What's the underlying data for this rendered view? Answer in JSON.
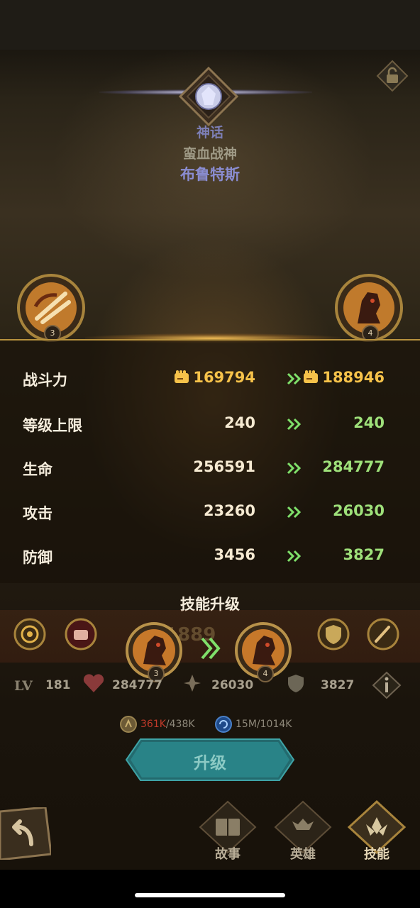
{
  "hero": {
    "rarity": "神话",
    "epithet": "蛮血战神",
    "name": "布鲁特斯"
  },
  "side_skills": {
    "left_level": "3",
    "right_level": "4"
  },
  "stats": {
    "power_label": "战斗力",
    "power_cur": "169794",
    "power_next": "188946",
    "rows": [
      {
        "label": "等级上限",
        "cur": "240",
        "next": "240"
      },
      {
        "label": "生命",
        "cur": "256591",
        "next": "284777"
      },
      {
        "label": "攻击",
        "cur": "23260",
        "next": "26030"
      },
      {
        "label": "防御",
        "cur": "3456",
        "next": "3827"
      }
    ]
  },
  "skill_upgrade": {
    "title": "技能升级",
    "from_level": "3",
    "to_level": "4",
    "ghost_power": "1889"
  },
  "info_bar": {
    "lv_label": "LV",
    "level": "181",
    "hp": "284777",
    "atk": "26030",
    "def": "3827"
  },
  "resources": {
    "gold_have": "361K",
    "gold_need": "/438K",
    "exp_have": "15M",
    "exp_need": "/1014K"
  },
  "upgrade_button": "升级",
  "tabs": [
    {
      "label": "故事",
      "icon": "book-icon"
    },
    {
      "label": "英雄",
      "icon": "hero-helmet-icon"
    },
    {
      "label": "技能",
      "icon": "skill-lotus-icon"
    }
  ],
  "colors": {
    "power": "#f6c24a",
    "next_value": "#9ee07a",
    "arrow": "#7fe06a",
    "red_shortage": "#c23a2a",
    "button": "#2c8e92"
  }
}
